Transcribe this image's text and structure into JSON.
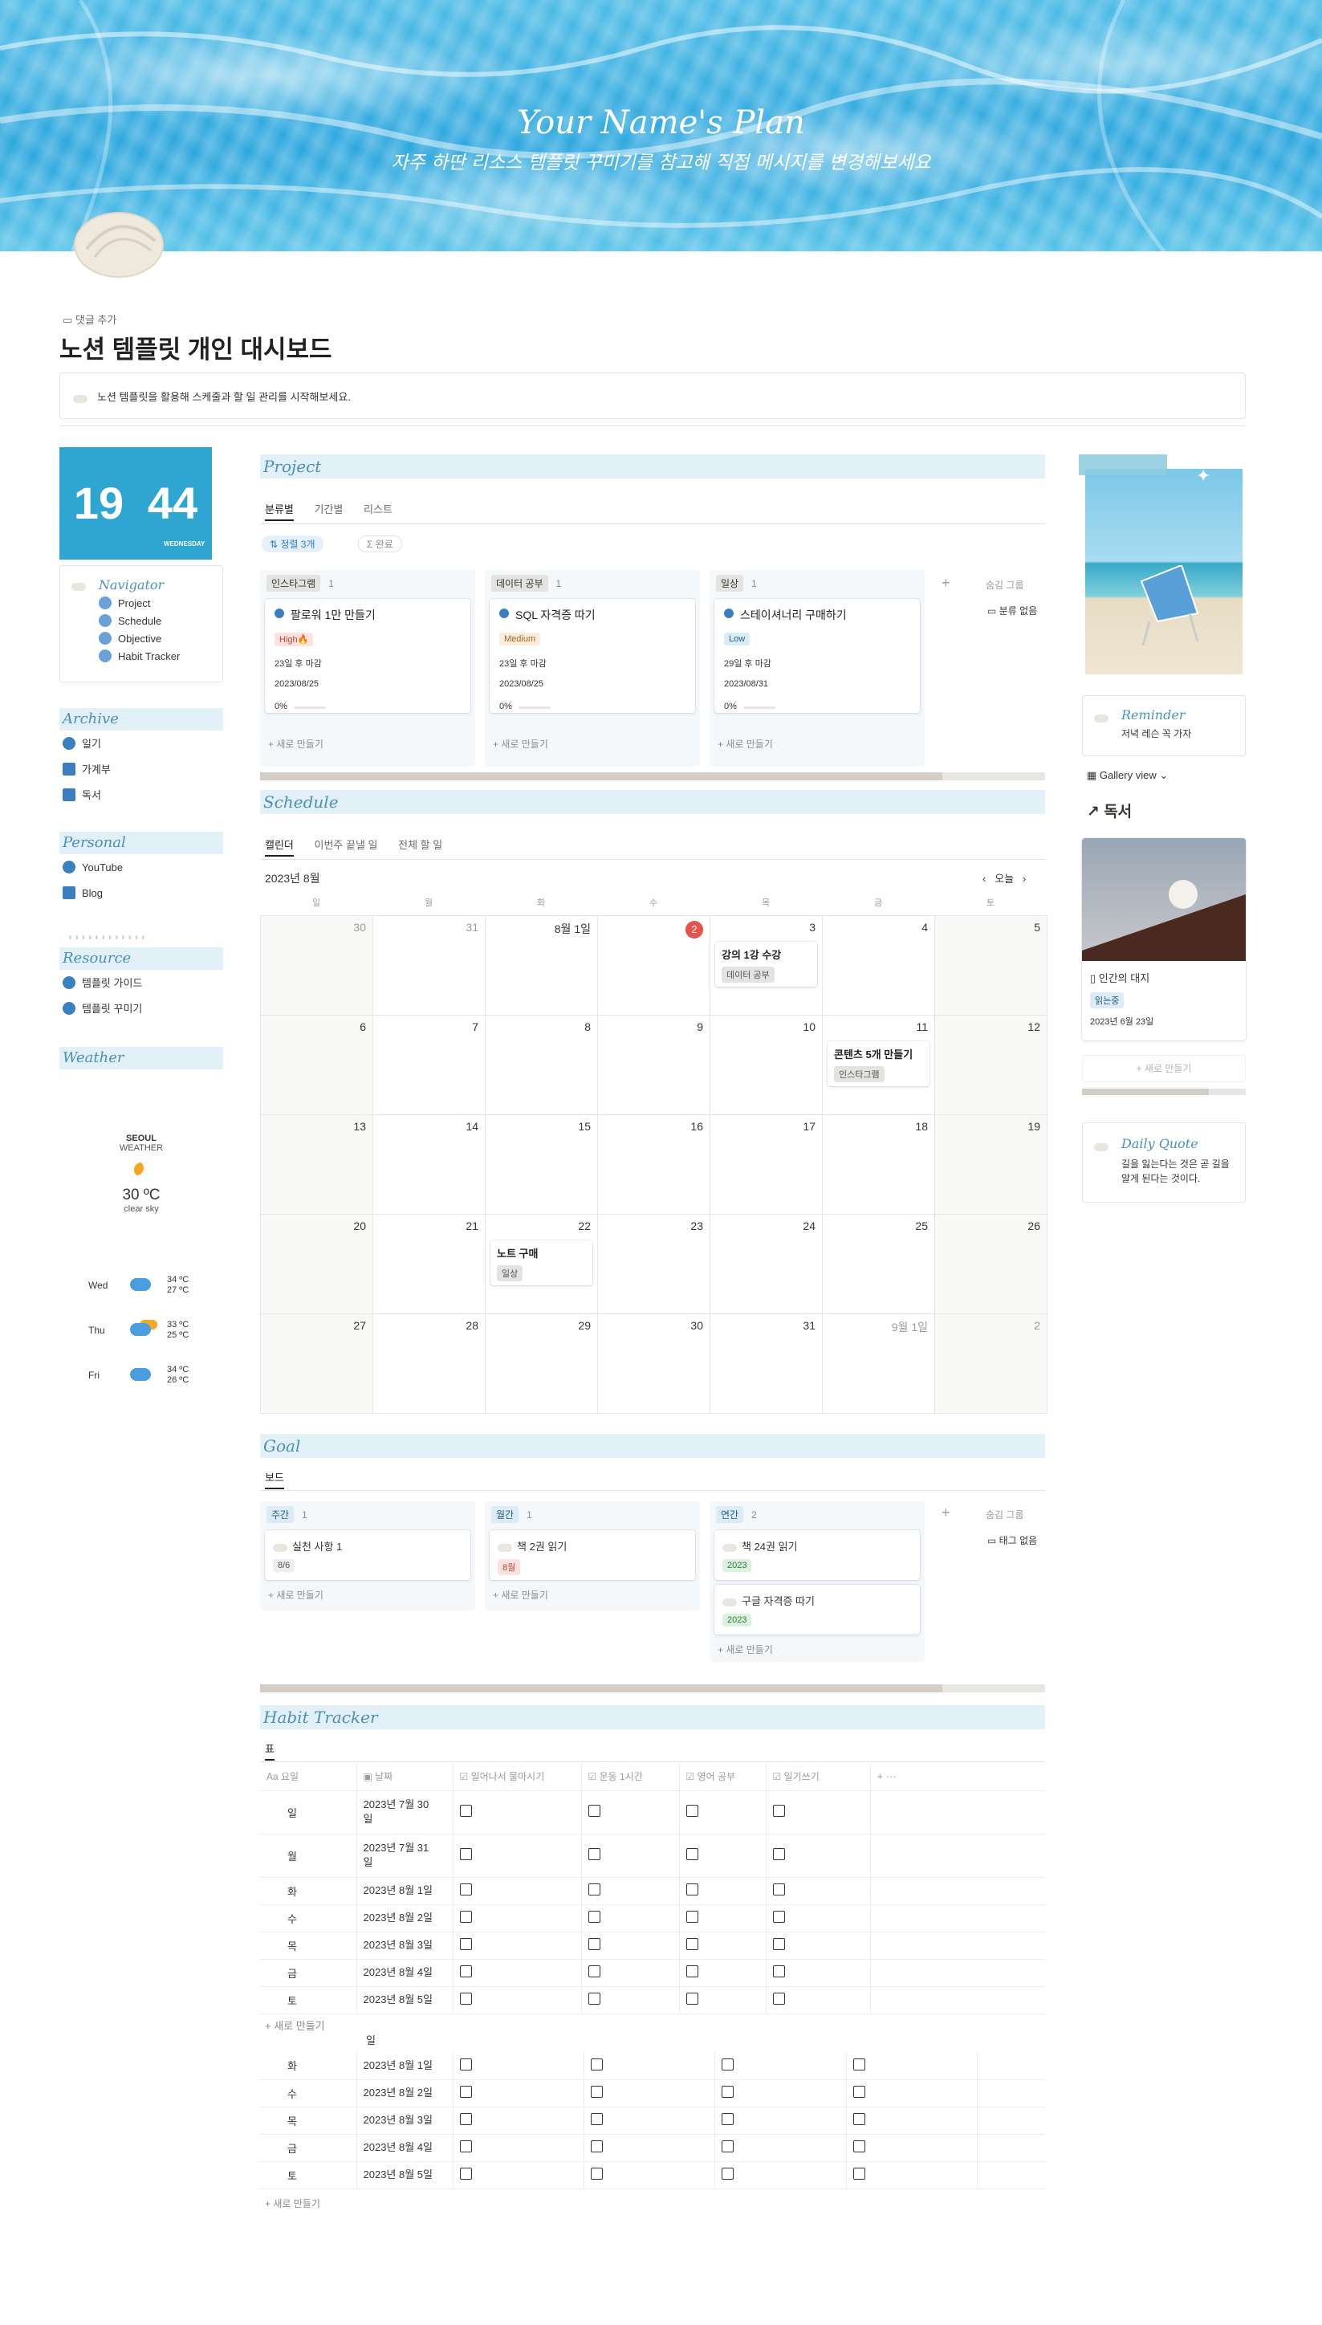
{
  "cover": {
    "title": "Your Name's Plan",
    "subtitle": "자주 하딴 리소스 템플릿 꾸미기를 참고해 직접 메시지를 변경해보세요"
  },
  "page": {
    "comment": "댓글 추가",
    "title": "노션 템플릿 개인 대시보드",
    "callout": "노션 템플릿을 활용해 스케줄과 할 일 관리를 시작해보세요."
  },
  "clock": {
    "hour": "19",
    "minute": "44",
    "day": "WEDNESDAY"
  },
  "navigator": {
    "title": "Navigator",
    "items": [
      "Project",
      "Schedule",
      "Objective",
      "Habit Tracker"
    ]
  },
  "archive": {
    "title": "Archive",
    "items": [
      "일기",
      "가계부",
      "독서"
    ]
  },
  "personal": {
    "title": "Personal",
    "items": [
      "YouTube",
      "Blog"
    ]
  },
  "resource": {
    "title": "Resource",
    "items": [
      "템플릿 가이드",
      "템플릿 꾸미기"
    ]
  },
  "weather": {
    "title": "Weather",
    "city": "SEOUL",
    "label": "WEATHER",
    "temp": "30 ºC",
    "desc": "clear sky",
    "forecast": [
      {
        "day": "Wed",
        "hi": "34 ºC",
        "lo": "27 ºC"
      },
      {
        "day": "Thu",
        "hi": "33 ºC",
        "lo": "25 ºC"
      },
      {
        "day": "Fri",
        "hi": "34 ºC",
        "lo": "26 ºC"
      }
    ]
  },
  "project": {
    "title": "Project",
    "tabs": [
      "분류별",
      "기간별",
      "리스트"
    ],
    "sort": "정렬 3개",
    "filter": "완료",
    "hidden": "숨김 그룹",
    "hidden_item": "분류 없음",
    "new": "새로 만들기",
    "columns": [
      {
        "name": "인스타그램",
        "count": "1",
        "card": {
          "title": "팔로워 1만 만들기",
          "priority": "High🔥",
          "due": "23일 후 마감",
          "date": "2023/08/25",
          "progress": "0%"
        }
      },
      {
        "name": "데이터 공부",
        "count": "1",
        "card": {
          "title": "SQL 자격증 따기",
          "priority": "Medium",
          "due": "23일 후 마감",
          "date": "2023/08/25",
          "progress": "0%"
        }
      },
      {
        "name": "일상",
        "count": "1",
        "card": {
          "title": "스테이셔너리 구매하기",
          "priority": "Low",
          "due": "29일 후 마감",
          "date": "2023/08/31",
          "progress": "0%"
        }
      }
    ]
  },
  "schedule": {
    "title": "Schedule",
    "tabs": [
      "캘린더",
      "이번주 끝낼 일",
      "전체 할 일"
    ],
    "month": "2023년 8월",
    "today": "오늘",
    "weekdays": [
      "일",
      "월",
      "화",
      "수",
      "목",
      "금",
      "토"
    ],
    "weeks": [
      [
        "30",
        "31",
        "8월 1일",
        "2",
        "3",
        "4",
        "5"
      ],
      [
        "6",
        "7",
        "8",
        "9",
        "10",
        "11",
        "12"
      ],
      [
        "13",
        "14",
        "15",
        "16",
        "17",
        "18",
        "19"
      ],
      [
        "20",
        "21",
        "22",
        "23",
        "24",
        "25",
        "26"
      ],
      [
        "27",
        "28",
        "29",
        "30",
        "31",
        "9월 1일",
        "2"
      ]
    ],
    "events": [
      {
        "title": "강의 1강 수강",
        "tag": "데이터 공부"
      },
      {
        "title": "콘텐츠 5개 만들기",
        "tag": "인스타그램"
      },
      {
        "title": "노트 구매",
        "tag": "일상"
      }
    ]
  },
  "goal": {
    "title": "Goal",
    "tab": "보드",
    "hidden": "숨김 그룹",
    "hidden_item": "태그 없음",
    "new": "새로 만들기",
    "columns": [
      {
        "name": "주간",
        "count": "1",
        "cards": [
          {
            "title": "실천 사항 1",
            "tag": "8/6"
          }
        ]
      },
      {
        "name": "월간",
        "count": "1",
        "cards": [
          {
            "title": "책 2권 읽기",
            "tag": "8월"
          }
        ]
      },
      {
        "name": "연간",
        "count": "2",
        "cards": [
          {
            "title": "책 24권 읽기",
            "tag": "2023"
          },
          {
            "title": "구글 자격증 따기",
            "tag": "2023"
          }
        ]
      }
    ]
  },
  "habit": {
    "title": "Habit Tracker",
    "tab": "표",
    "headers": [
      "Aa 요일",
      "날짜",
      "일어나서 물마시기",
      "운동 1시간",
      "영어 공부",
      "일기쓰기"
    ],
    "rows1": [
      [
        "일",
        "2023년 7월 30\n일"
      ],
      [
        "월",
        "2023년 7월 31\n일"
      ],
      [
        "화",
        "2023년 8월 1일"
      ],
      [
        "수",
        "2023년 8월 2일"
      ],
      [
        "목",
        "2023년 8월 3일"
      ],
      [
        "금",
        "2023년 8월 4일"
      ],
      [
        "토",
        "2023년 8월 5일"
      ]
    ],
    "group_label": "일",
    "rows2": [
      [
        "화",
        "2023년 8월 1일"
      ],
      [
        "수",
        "2023년 8월 2일"
      ],
      [
        "목",
        "2023년 8월 3일"
      ],
      [
        "금",
        "2023년 8월 4일"
      ],
      [
        "토",
        "2023년 8월 5일"
      ]
    ],
    "new": "새로 만들기"
  },
  "reminder": {
    "title": "Reminder",
    "text": "저녁 레슨 꼭 가자"
  },
  "gallery": {
    "view": "Gallery view",
    "heading": "↗ 독서",
    "card_title": "인간의 대지",
    "tag": "읽는중",
    "date": "2023년 6월 23일",
    "new": "새로 만들기"
  },
  "quote": {
    "title": "Daily Quote",
    "text": "길을 잃는다는 것은 곧 길을 알게 된다는 것이다."
  }
}
